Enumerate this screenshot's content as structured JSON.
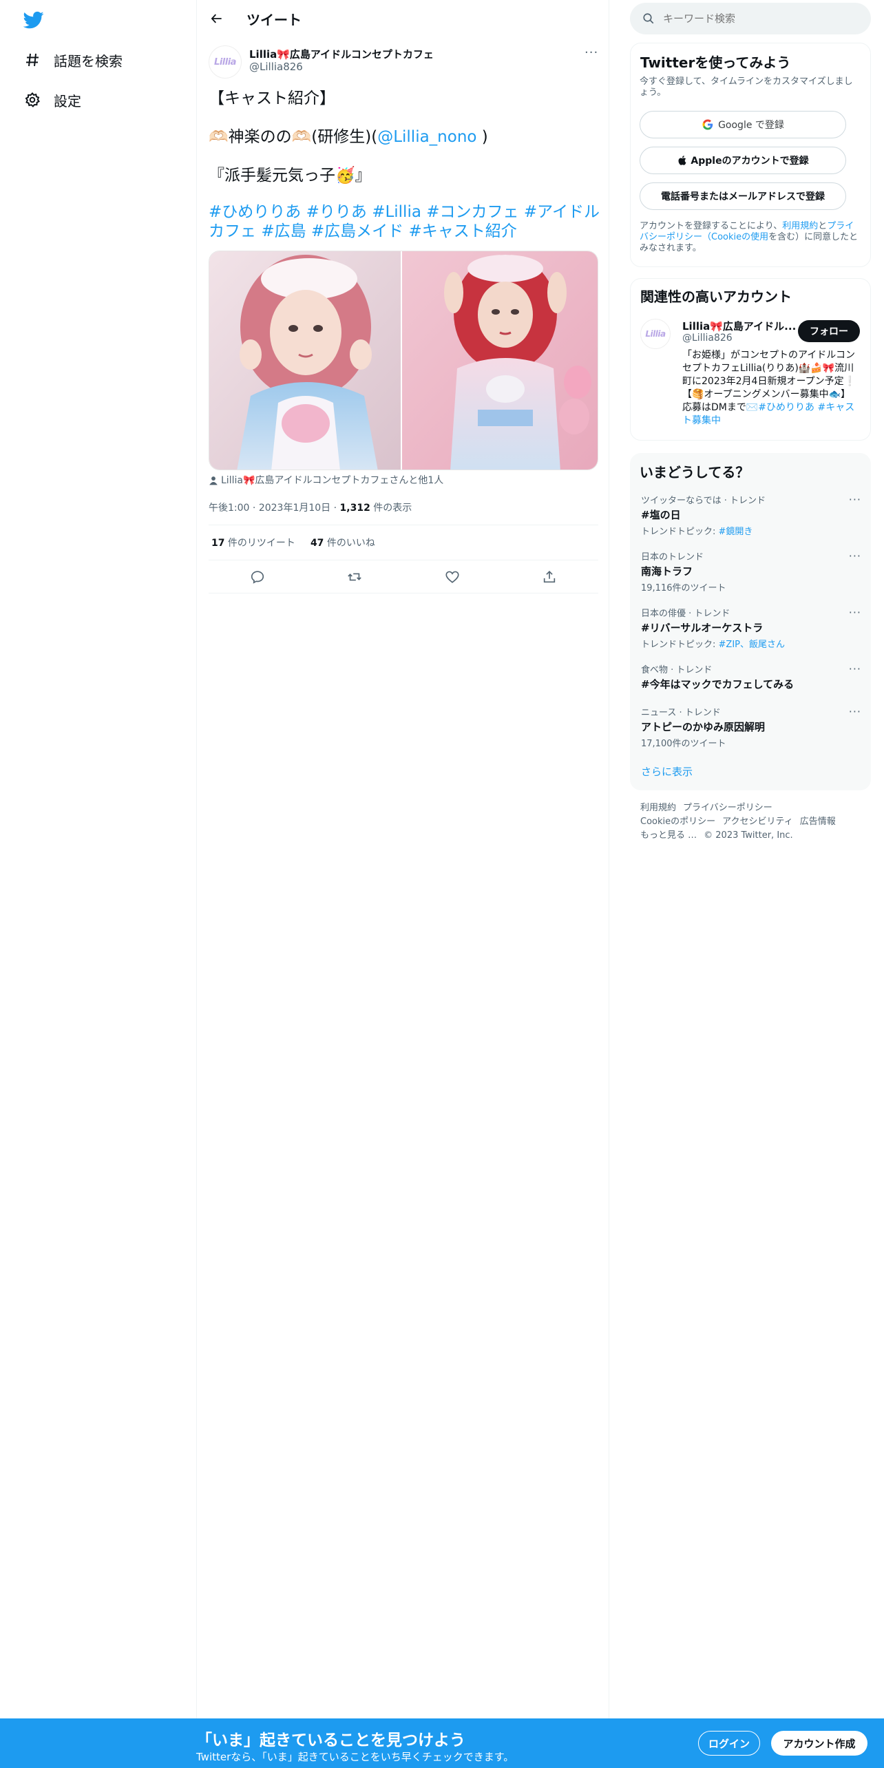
{
  "colors": {
    "accent": "#1d9bf0",
    "text": "#0f1419",
    "muted": "#536471",
    "border": "#eff3f4",
    "banner": "#1d9bf0"
  },
  "sidebar": {
    "logo_icon": "twitter-bird-icon",
    "items": [
      {
        "label": "話題を検索",
        "icon": "hashtag-icon"
      },
      {
        "label": "設定",
        "icon": "gear-icon"
      }
    ]
  },
  "header": {
    "back_icon": "arrow-left-icon",
    "title": "ツイート"
  },
  "tweet": {
    "author": {
      "name": "Lillia🎀広島アイドルコンセプトカフェ",
      "handle": "@Lillia826",
      "avatar_text": "Lillia"
    },
    "lines": {
      "line1": "【キャスト紹介】",
      "line2_prefix": "🫶🏻神楽のの🫶🏻(研修生)(",
      "line2_mention": "@Lillia_nono",
      "line2_suffix": " )",
      "line3": "『派手髪元気っ子🥳』"
    },
    "hashtags": [
      "#ひめりりあ",
      "#りりあ",
      "#Lillia",
      "#コンカフェ",
      "#アイドルカフェ",
      "#広島",
      "#広島メイド",
      "#キャスト紹介"
    ],
    "tagged": "Lillia🎀広島アイドルコンセプトカフェさんと他1人",
    "time": "午後1:00",
    "date": "2023年1月10日",
    "views_count": "1,312",
    "views_label": " 件の表示",
    "retweets_count": "17",
    "retweets_label": " 件のリツイート",
    "likes_count": "47",
    "likes_label": " 件のいいね",
    "action_icons": [
      "reply-icon",
      "retweet-icon",
      "like-icon",
      "share-icon"
    ]
  },
  "search": {
    "placeholder": "キーワード検索"
  },
  "signup": {
    "title": "Twitterを使ってみよう",
    "subtitle": "今すぐ登録して、タイムラインをカスタマイズしましょう。",
    "google_label": "Google で登録",
    "apple_label": "Appleのアカウントで登録",
    "phone_label": "電話番号またはメールアドレスで登録",
    "terms_prefix": "アカウントを登録することにより、",
    "terms_link": "利用規約",
    "terms_and": "と",
    "privacy_link": "プライバシーポリシー",
    "cookie_link": "（Cookieの使用",
    "terms_suffix": "を含む）に同意したとみなされます。"
  },
  "related": {
    "title": "関連性の高いアカウント",
    "name": "Lillia🎀広島アイドル...",
    "handle": "@Lillia826",
    "follow_label": "フォロー",
    "bio": "「お姫様」がコンセプトのアイドルコンセプトカフェLillia(りりあ)🏰🍰🎀流川町に2023年2月4日新規オープン予定❕【🥞オープニングメンバー募集中🐟】応募はDMまで✉️",
    "bio_tags": "#ひめりりあ #キャスト募集中"
  },
  "trends": {
    "title": "いまどうしてる？",
    "items": [
      {
        "category": "ツイッターならでは · トレンド",
        "name": "#塩の日",
        "sub_prefix": "トレンドトピック: ",
        "sub_link": "#鏡開き"
      },
      {
        "category": "日本のトレンド",
        "name": "南海トラフ",
        "sub_prefix": "19,116件のツイート",
        "sub_link": ""
      },
      {
        "category": "日本の俳優 · トレンド",
        "name": "#リバーサルオーケストラ",
        "sub_prefix": "トレンドトピック: ",
        "sub_link": "#ZIP、飯尾さん"
      },
      {
        "category": "食べ物 · トレンド",
        "name": "#今年はマックでカフェしてみる",
        "sub_prefix": "",
        "sub_link": ""
      },
      {
        "category": "ニュース · トレンド",
        "name": "アトピーのかゆみ原因解明",
        "sub_prefix": "17,100件のツイート",
        "sub_link": ""
      }
    ],
    "show_more": "さらに表示"
  },
  "footer": {
    "links": [
      "利用規約",
      "プライバシーポリシー",
      "Cookieのポリシー",
      "アクセシビリティ",
      "広告情報",
      "もっと見る …"
    ],
    "copyright": "© 2023 Twitter, Inc."
  },
  "banner": {
    "title": "「いま」起きていることを見つけよう",
    "subtitle": "Twitterなら、「いま」起きていることをいち早くチェックできます。",
    "login_label": "ログイン",
    "signup_label": "アカウント作成"
  }
}
